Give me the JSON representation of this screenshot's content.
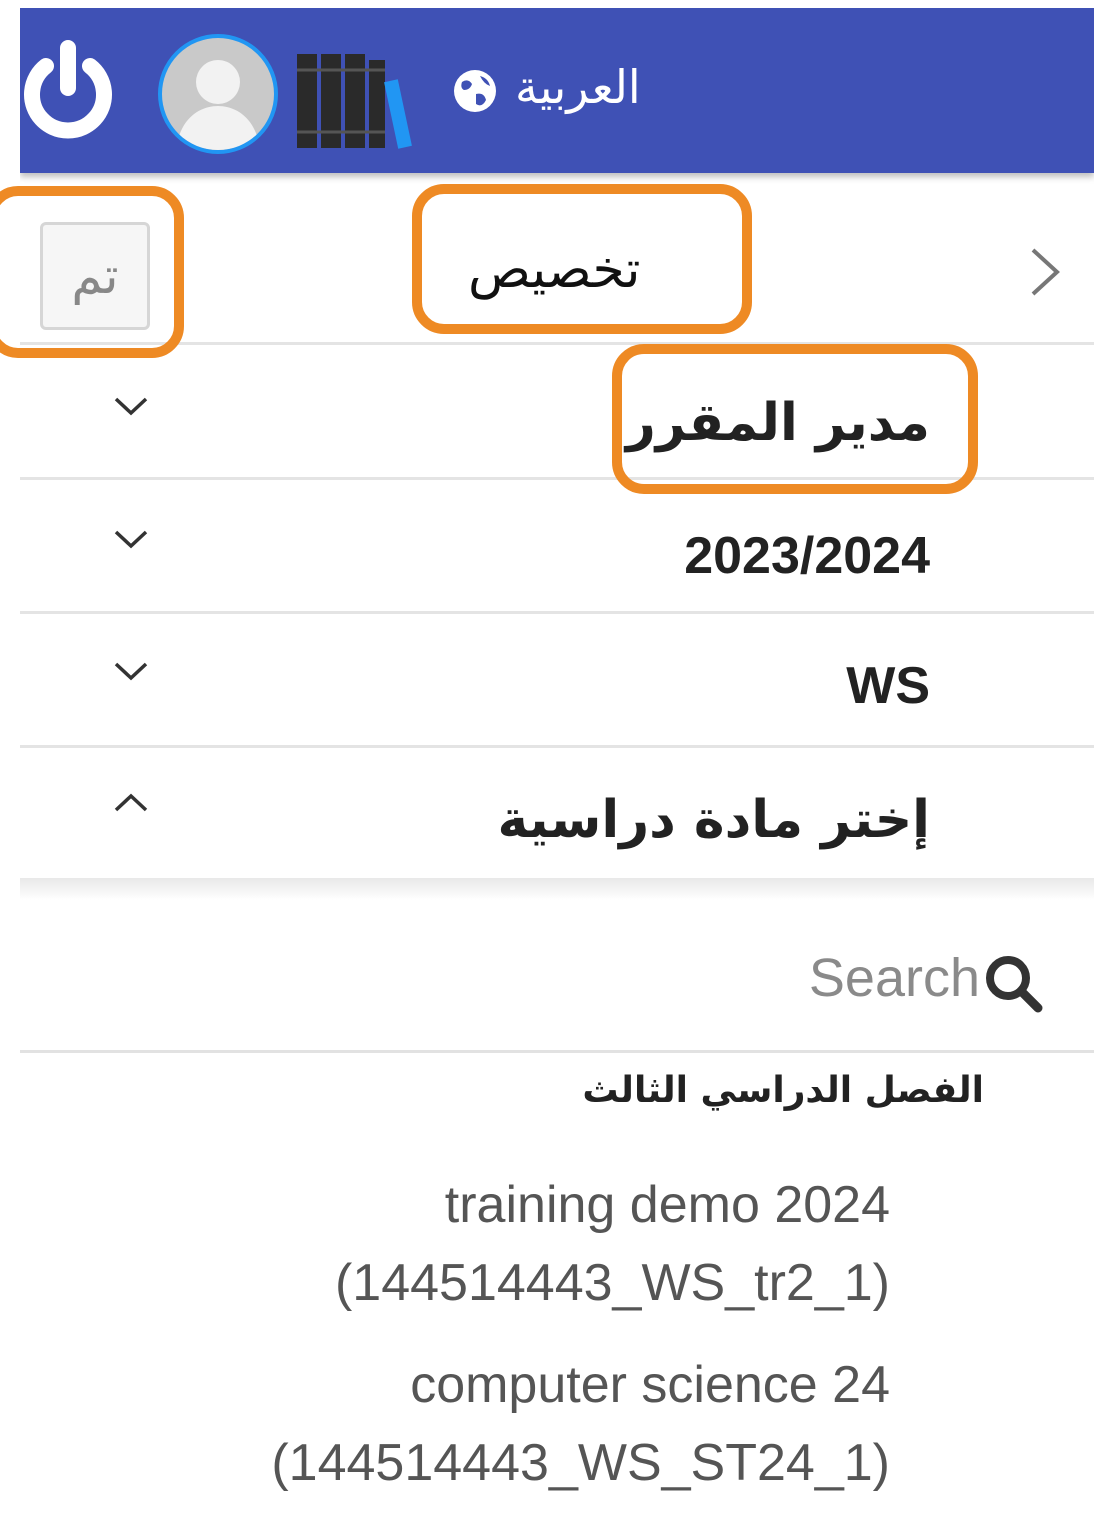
{
  "header": {
    "language_label": "العربية",
    "icons": {
      "power": "power-icon",
      "avatar": "user-avatar",
      "library": "books-icon",
      "language": "globe-icon"
    },
    "colors": {
      "bar": "#3f51b5",
      "avatar_ring": "#2196f3",
      "accent_book": "#2196f3"
    }
  },
  "title_bar": {
    "done_label": "تم",
    "title": "تخصيص",
    "back_icon": "chevron-right-icon"
  },
  "filters": [
    {
      "label": "مدير المقرر",
      "chevron": "chevron-down-icon"
    },
    {
      "label": "2023/2024",
      "chevron": "chevron-down-icon"
    },
    {
      "label": "WS",
      "chevron": "chevron-down-icon"
    },
    {
      "label": "إختر مادة دراسية",
      "chevron": "chevron-up-icon"
    }
  ],
  "search": {
    "placeholder": "Search",
    "value": ""
  },
  "course_list": {
    "group_header": "الفصل الدراسي الثالث",
    "items": [
      {
        "line1": "training demo 2024",
        "line2": "(144514443_WS_tr2_1)"
      },
      {
        "line1": "computer science 24",
        "line2": "(144514443_WS_ST24_1)"
      }
    ]
  },
  "highlight_color": "#ee8a24"
}
